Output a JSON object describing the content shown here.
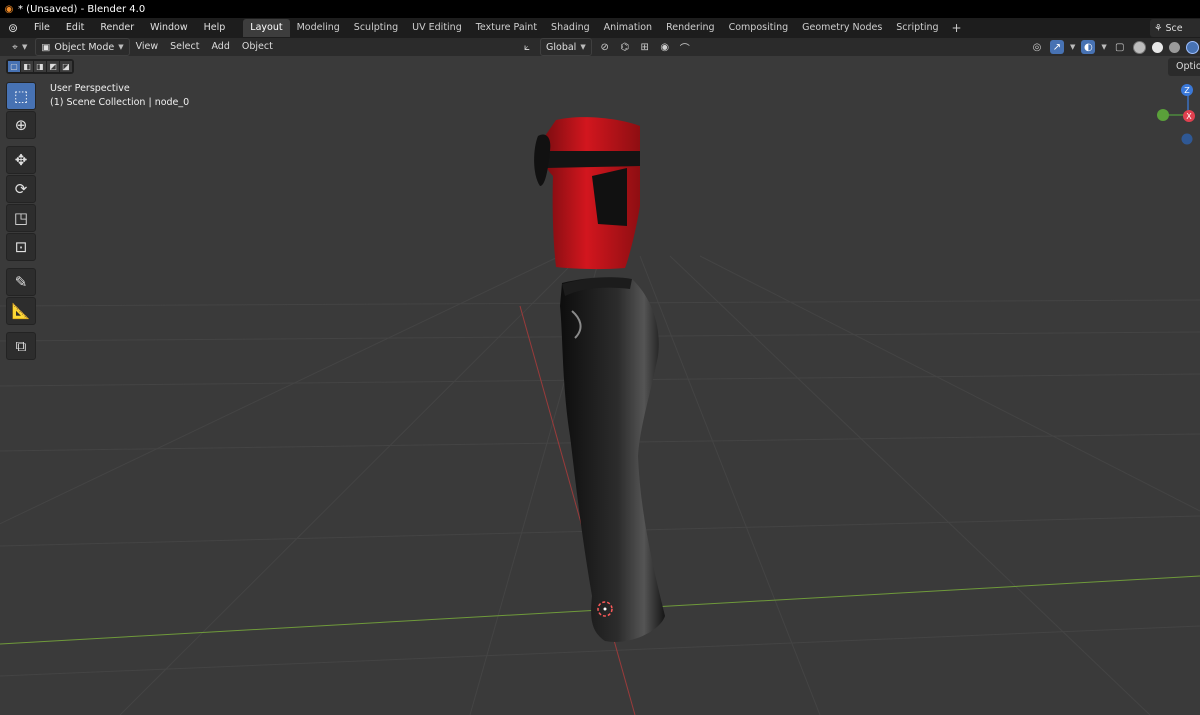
{
  "window": {
    "title": "* (Unsaved) - Blender 4.0"
  },
  "menu": {
    "items": [
      "File",
      "Edit",
      "Render",
      "Window",
      "Help"
    ]
  },
  "workspaces": {
    "tabs": [
      "Layout",
      "Modeling",
      "Sculpting",
      "UV Editing",
      "Texture Paint",
      "Shading",
      "Animation",
      "Rendering",
      "Compositing",
      "Geometry Nodes",
      "Scripting"
    ],
    "active": "Layout",
    "add_label": "+"
  },
  "scene_selector": {
    "label": "Sce"
  },
  "viewport_header": {
    "mode": "Object Mode",
    "menus": [
      "View",
      "Select",
      "Add",
      "Object"
    ],
    "orientation": "Global"
  },
  "options": {
    "label": "Option"
  },
  "overlay": {
    "perspective": "User Perspective",
    "collection": "(1) Scene Collection | node_0"
  },
  "gizmo": {
    "z_label": "Z",
    "x_label": "X"
  },
  "colors": {
    "accent": "#4772b3",
    "grid_x_axis": "#9a3b3b",
    "grid_y_axis": "#6f9a3a",
    "garment_top": "#c8141c",
    "garment_pants": "#1a1a1a"
  },
  "toolbar": {
    "tools": [
      "select-box",
      "cursor",
      "move",
      "rotate",
      "scale",
      "transform",
      "annotate",
      "measure",
      "add-cube"
    ]
  }
}
